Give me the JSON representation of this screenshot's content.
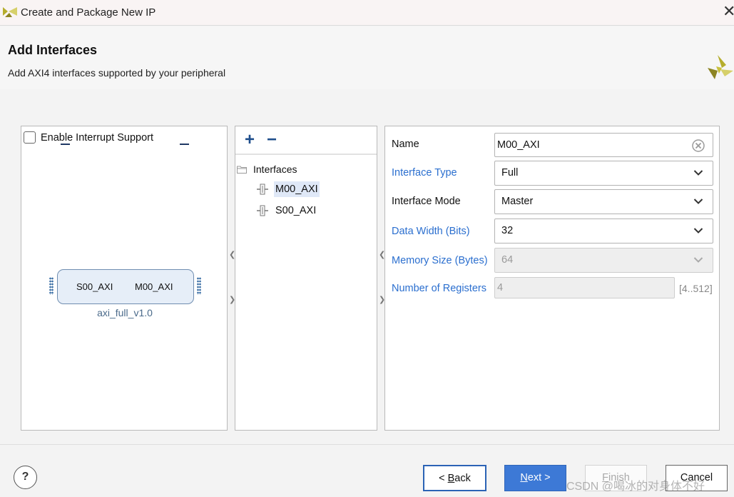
{
  "window": {
    "title": "Create and Package New IP",
    "close_glyph": "✕"
  },
  "header": {
    "title": "Add Interfaces",
    "subtitle": "Add AXI4 interfaces supported by your peripheral"
  },
  "symbol_panel": {
    "interrupt_checkbox_label": "Enable Interrupt Support",
    "interrupt_checked": false,
    "ip_block": {
      "left_port": "S00_AXI",
      "right_port": "M00_AXI",
      "name": "axi_full_v1.0"
    }
  },
  "interfaces_panel": {
    "add_glyph": "+",
    "remove_glyph": "−",
    "root_label": "Interfaces",
    "items": [
      {
        "label": "M00_AXI",
        "selected": true
      },
      {
        "label": "S00_AXI",
        "selected": false
      }
    ]
  },
  "properties": {
    "name": {
      "label": "Name",
      "value": "M00_AXI"
    },
    "interface_type": {
      "label": "Interface Type",
      "value": "Full"
    },
    "interface_mode": {
      "label": "Interface Mode",
      "value": "Master"
    },
    "data_width": {
      "label": "Data Width (Bits)",
      "value": "32"
    },
    "memory_size": {
      "label": "Memory Size (Bytes)",
      "value": "64"
    },
    "num_registers": {
      "label": "Number of Registers",
      "value": "4",
      "range": "[4..512]"
    }
  },
  "footer": {
    "help": "?",
    "back": {
      "prefix": "< ",
      "mnemonic": "B",
      "rest": "ack"
    },
    "next": {
      "mnemonic": "N",
      "rest": "ext >"
    },
    "finish": {
      "mnemonic": "F",
      "rest": "inish"
    },
    "cancel": "Cancel"
  },
  "watermark": "CSDN @喝冰的对身体不好",
  "colors": {
    "accent": "#3d79d6",
    "link_label": "#2b6fcf",
    "logo": "#b5ad2c"
  },
  "icons": {
    "app_logo": "xilinx-logo-icon",
    "clear": "clear-circle-icon",
    "dropdown": "chevron-down-icon",
    "folder": "folder-open-icon",
    "bus": "bus-interface-icon"
  }
}
